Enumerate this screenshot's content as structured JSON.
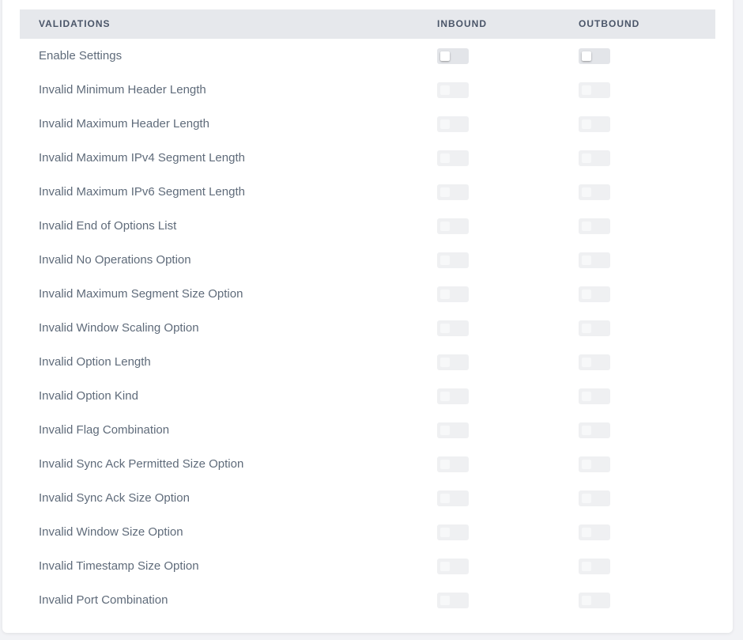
{
  "header": {
    "validations": "VALIDATIONS",
    "inbound": "INBOUND",
    "outbound": "OUTBOUND"
  },
  "rows": [
    {
      "label": "Enable Settings",
      "inbound": false,
      "outbound": false,
      "enabled": true
    },
    {
      "label": "Invalid Minimum Header Length",
      "inbound": false,
      "outbound": false,
      "enabled": false
    },
    {
      "label": "Invalid Maximum Header Length",
      "inbound": false,
      "outbound": false,
      "enabled": false
    },
    {
      "label": "Invalid Maximum IPv4 Segment Length",
      "inbound": false,
      "outbound": false,
      "enabled": false
    },
    {
      "label": "Invalid Maximum IPv6 Segment Length",
      "inbound": false,
      "outbound": false,
      "enabled": false
    },
    {
      "label": "Invalid End of Options List",
      "inbound": false,
      "outbound": false,
      "enabled": false
    },
    {
      "label": "Invalid No Operations Option",
      "inbound": false,
      "outbound": false,
      "enabled": false
    },
    {
      "label": "Invalid Maximum Segment Size Option",
      "inbound": false,
      "outbound": false,
      "enabled": false
    },
    {
      "label": "Invalid Window Scaling Option",
      "inbound": false,
      "outbound": false,
      "enabled": false
    },
    {
      "label": "Invalid Option Length",
      "inbound": false,
      "outbound": false,
      "enabled": false
    },
    {
      "label": "Invalid Option Kind",
      "inbound": false,
      "outbound": false,
      "enabled": false
    },
    {
      "label": "Invalid Flag Combination",
      "inbound": false,
      "outbound": false,
      "enabled": false
    },
    {
      "label": "Invalid Sync Ack Permitted Size Option",
      "inbound": false,
      "outbound": false,
      "enabled": false
    },
    {
      "label": "Invalid Sync Ack Size Option",
      "inbound": false,
      "outbound": false,
      "enabled": false
    },
    {
      "label": "Invalid Window Size Option",
      "inbound": false,
      "outbound": false,
      "enabled": false
    },
    {
      "label": "Invalid Timestamp Size Option",
      "inbound": false,
      "outbound": false,
      "enabled": false
    },
    {
      "label": "Invalid Port Combination",
      "inbound": false,
      "outbound": false,
      "enabled": false
    }
  ]
}
